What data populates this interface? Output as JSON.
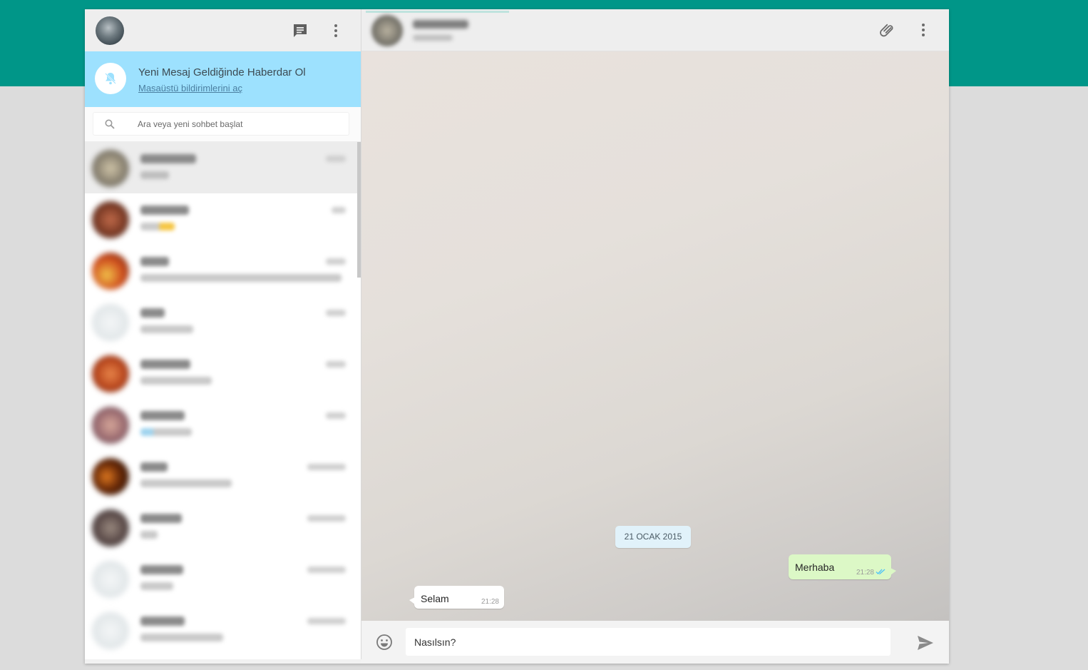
{
  "colors": {
    "brand_teal": "#009688",
    "notify_banner": "#9de1fe",
    "outgoing_bubble": "#dcf8c6",
    "date_chip": "#e1f2fa",
    "read_tick": "#4fc3f7"
  },
  "sidebar": {
    "header_icons": [
      "new-chat-icon",
      "menu-dots-icon"
    ],
    "notification": {
      "title": "Yeni Mesaj Geldiğinde Haberdar Ol",
      "link": "Masaüstü bildirimlerini aç",
      "icon": "bell-off-icon"
    },
    "search": {
      "placeholder": "Ara veya yeni sohbet başlat",
      "icon": "search-icon"
    }
  },
  "conversation": {
    "header_icons": [
      "attach-icon",
      "menu-dots-icon"
    ],
    "date": "21 OCAK 2015",
    "messages": [
      {
        "direction": "out",
        "text": "Merhaba",
        "time": "21:28",
        "status": "read"
      },
      {
        "direction": "in",
        "text": "Selam",
        "time": "21:28"
      }
    ],
    "composer": {
      "value": "Nasılsın?",
      "emoji_icon": "emoji-icon",
      "send_icon": "send-icon"
    }
  }
}
